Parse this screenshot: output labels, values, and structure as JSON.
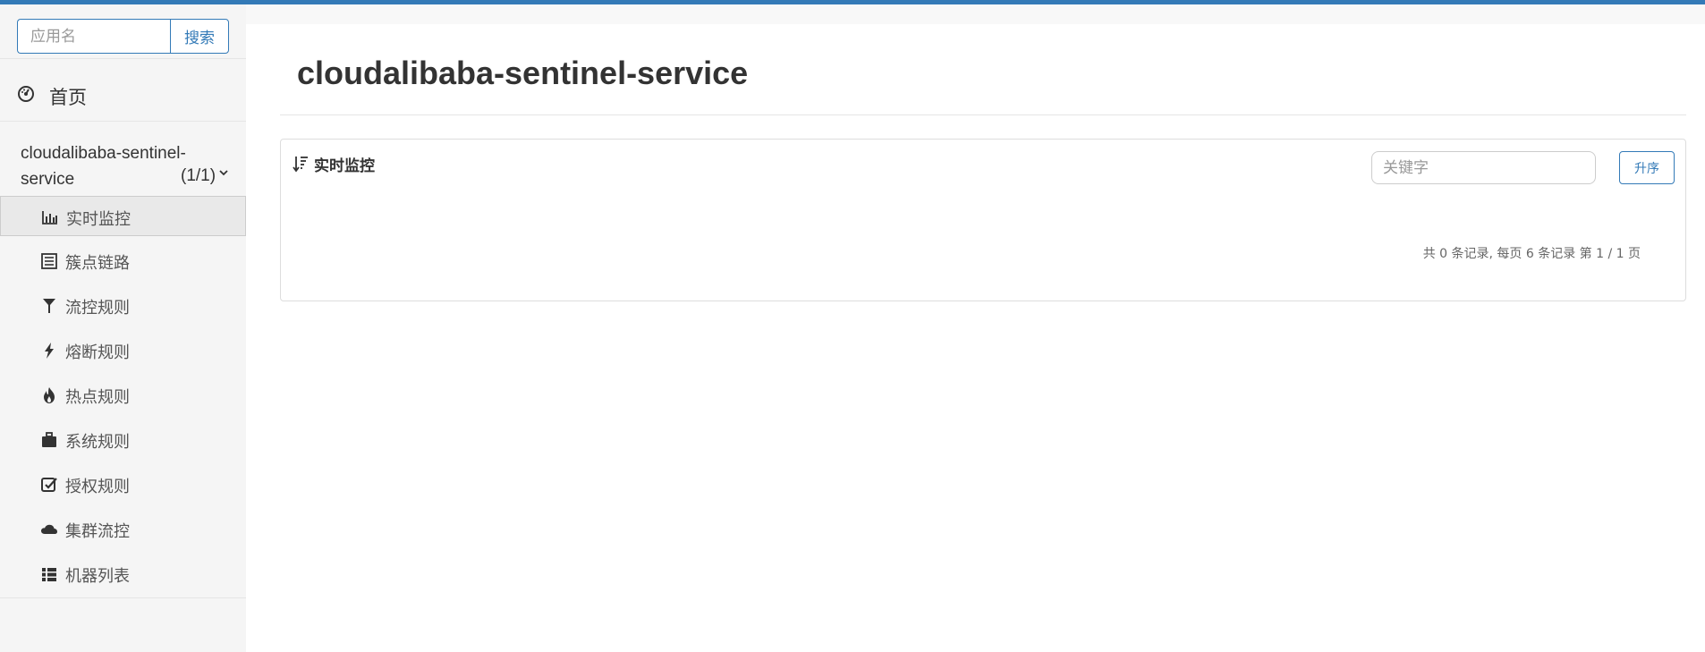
{
  "colors": {
    "accent": "#337ab7",
    "sidebar_bg": "#f5f5f5",
    "active_bg": "#e9e9e9"
  },
  "sidebar": {
    "search": {
      "placeholder": "应用名",
      "button_label": "搜索"
    },
    "home": {
      "label": "首页",
      "icon": "dashboard-icon"
    },
    "app": {
      "name": "cloudalibaba-sentinel-service",
      "count": "(1/1)",
      "icon": "chevron-down-icon"
    },
    "items": [
      {
        "label": "实时监控",
        "icon": "bar-chart-icon",
        "active": true
      },
      {
        "label": "簇点链路",
        "icon": "list-alt-icon",
        "active": false
      },
      {
        "label": "流控规则",
        "icon": "filter-icon",
        "active": false
      },
      {
        "label": "熔断规则",
        "icon": "flash-icon",
        "active": false
      },
      {
        "label": "热点规则",
        "icon": "fire-icon",
        "active": false
      },
      {
        "label": "系统规则",
        "icon": "briefcase-icon",
        "active": false
      },
      {
        "label": "授权规则",
        "icon": "check-square-icon",
        "active": false
      },
      {
        "label": "集群流控",
        "icon": "cloud-icon",
        "active": false
      },
      {
        "label": "机器列表",
        "icon": "th-list-icon",
        "active": false
      }
    ]
  },
  "main": {
    "title": "cloudalibaba-sentinel-service",
    "panel": {
      "heading": "实时监控",
      "heading_icon": "sort-amount-icon",
      "keyword_placeholder": "关键字",
      "sort_button": "升序",
      "pager_text": "共 0 条记录, 每页 6 条记录 第 1 / 1 页"
    }
  }
}
